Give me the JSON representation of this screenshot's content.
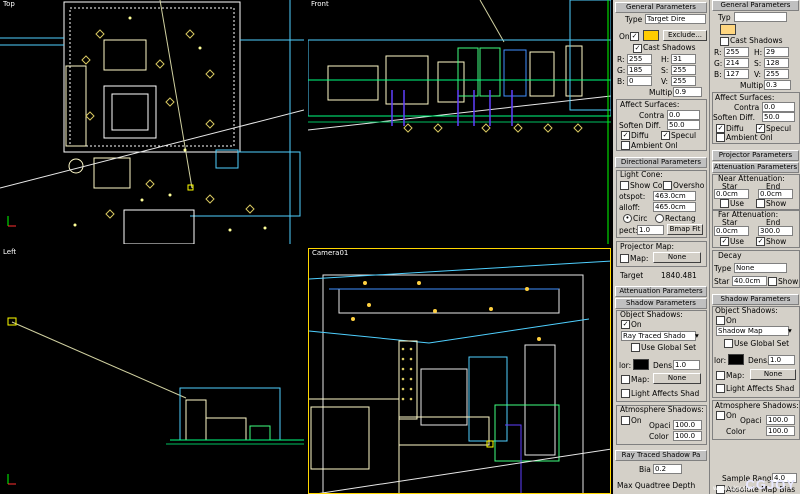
{
  "viewports": {
    "top": "Top",
    "front": "Front",
    "left": "Left",
    "camera": "Camera01"
  },
  "panel_a": {
    "general_header": "General Parameters",
    "type_label": "Type",
    "type_value": "Target Dire",
    "on_label": "On",
    "exclude_button": "Exclude...",
    "cast_shadows": "Cast Shadows",
    "r_label": "R:",
    "r_value": "255",
    "g_label": "G:",
    "g_value": "185",
    "b_label": "B:",
    "b_value": "0",
    "h_label": "H:",
    "h_value": "31",
    "s_label": "S:",
    "s_value": "255",
    "v_label": "V:",
    "v_value": "255",
    "multiplier_label": "Multip",
    "multiplier_value": "0.9",
    "affect_surfaces": "Affect Surfaces:",
    "contrast_label": "Contra",
    "contrast_value": "0.0",
    "soften_label": "Soften Diff.",
    "soften_value": "50.0",
    "diffuse": "Diffu",
    "specular": "Specul",
    "ambient": "Ambient Onl",
    "directional_header": "Directional Parameters",
    "light_cone": "Light Cone:",
    "show_cone": "Show Con",
    "overshoot": "Oversho",
    "hotspot_label": "otspot:",
    "hotspot_value": "463.0cm",
    "falloff_label": "alloff:",
    "falloff_value": "465.0cm",
    "circle": "Circ",
    "rectangle": "Rectang",
    "aspect_label": "pect:",
    "aspect_value": "1.0",
    "bitmap_fit": "Bmap Fit",
    "projector_map": "Projector Map:",
    "map_label": "Map:",
    "none_button": "None",
    "target_label": "Target",
    "target_value": "1840.481",
    "atten_header": "Attenuation Parameters",
    "shadow_header": "Shadow Parameters",
    "object_shadows": "Object Shadows:",
    "shadow_on": "On",
    "shadow_type": "Ray Traced Shado",
    "use_global": "Use Global Set",
    "color_label": "lor:",
    "dens_label": "Dens.",
    "dens_value": "1.0",
    "map2_label": "Map:",
    "none2_button": "None",
    "light_affects": "Light Affects Shad",
    "atmos_header": "Atmosphere Shadows:",
    "atmos_on": "On",
    "opacity_label": "Opaci",
    "opacity_value": "100.0",
    "color2_label": "Color",
    "color2_value": "100.0",
    "raytrace_header": "Ray Traced Shadow Pa",
    "bias_label": "Bia",
    "bias_value": "0.2",
    "max_quad": "Max Quadtree Depth"
  },
  "panel_b": {
    "general_header": "General Parameters",
    "type_label": "Typ",
    "cast_shadows": "Cast Shadows",
    "r_label": "R:",
    "r_value": "255",
    "g_label": "G:",
    "g_value": "214",
    "b_label": "B:",
    "b_value": "127",
    "h_label": "H:",
    "h_value": "29",
    "s_label": "S:",
    "s_value": "128",
    "v_label": "V:",
    "v_value": "255",
    "multiplier_label": "Multip",
    "multiplier_value": "0.3",
    "affect_surfaces": "Affect Surfaces:",
    "contrast_label": "Contra",
    "contrast_value": "0.0",
    "soften_label": "Soften Diff.",
    "soften_value": "50.0",
    "diffuse": "Diffu",
    "specular": "Specul",
    "ambient": "Ambient Onl",
    "projector_header": "Projector Parameters",
    "atten_header": "Attenuation Parameters",
    "near_atten": "Near Attenuation:",
    "start_label": "Star",
    "end_label": "End",
    "near_start": "0.0cm",
    "near_end": "0.0cm",
    "use_label": "Use",
    "show_label": "Show",
    "far_atten": "Far Attenuation:",
    "far_start_label": "Star",
    "far_end_label": "End",
    "far_start": "0.0cm",
    "far_end": "300.0",
    "far_use": "Use",
    "far_show": "Show",
    "decay_label": "Decay",
    "decay_type_label": "Type",
    "decay_type_value": "None",
    "decay_start_label": "Star",
    "decay_start_value": "40.0cm",
    "decay_show": "Show",
    "shadow_header": "Shadow Parameters",
    "object_shadows": "Object Shadows:",
    "shadow_on": "On",
    "shadow_type": "Shadow Map",
    "use_global": "Use Global Set",
    "color_label": "lor:",
    "dens_label": "Dens.",
    "dens_value": "1.0",
    "map_label": "Map:",
    "none_button": "None",
    "light_affects": "Light Affects Shad",
    "atmos_header": "Atmosphere Shadows:",
    "atmos_on": "On",
    "opacity_label": "Opaci",
    "opacity_value": "100.0",
    "color2_label": "Color",
    "color2_value": "100.0",
    "sample_label": "Sample Range",
    "sample_value": "4.0",
    "absolute_map_bias": "Absolute Map Bias"
  },
  "watermark": "CGJOY",
  "watermark_small": "www.cgjoy.com"
}
